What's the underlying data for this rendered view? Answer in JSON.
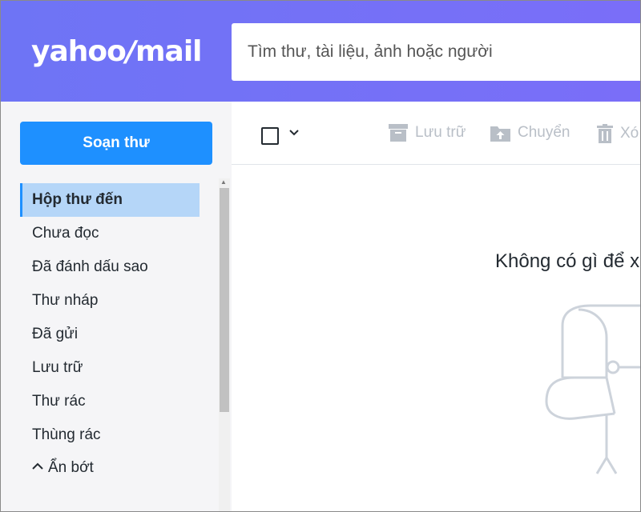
{
  "logo": {
    "yahoo": "yahoo",
    "slash": "/",
    "mail": "mail"
  },
  "search": {
    "placeholder": "Tìm thư, tài liệu, ảnh hoặc người"
  },
  "compose": {
    "label": "Soạn thư"
  },
  "sidebar": {
    "items": [
      {
        "label": "Hộp thư đến",
        "active": true
      },
      {
        "label": "Chưa đọc"
      },
      {
        "label": "Đã đánh dấu sao"
      },
      {
        "label": "Thư nháp"
      },
      {
        "label": "Đã gửi"
      },
      {
        "label": "Lưu trữ"
      },
      {
        "label": "Thư rác"
      },
      {
        "label": "Thùng rác"
      }
    ],
    "collapse_label": "Ẩn bớt"
  },
  "toolbar": {
    "archive_label": "Lưu trữ",
    "move_label": "Chuyển",
    "delete_label": "Xó"
  },
  "empty": {
    "message": "Không có gì để x"
  },
  "colors": {
    "header": "#6e74f5",
    "accent": "#1e90ff",
    "active_bg": "#b5d6f8",
    "disabled": "#b9bfc7"
  }
}
